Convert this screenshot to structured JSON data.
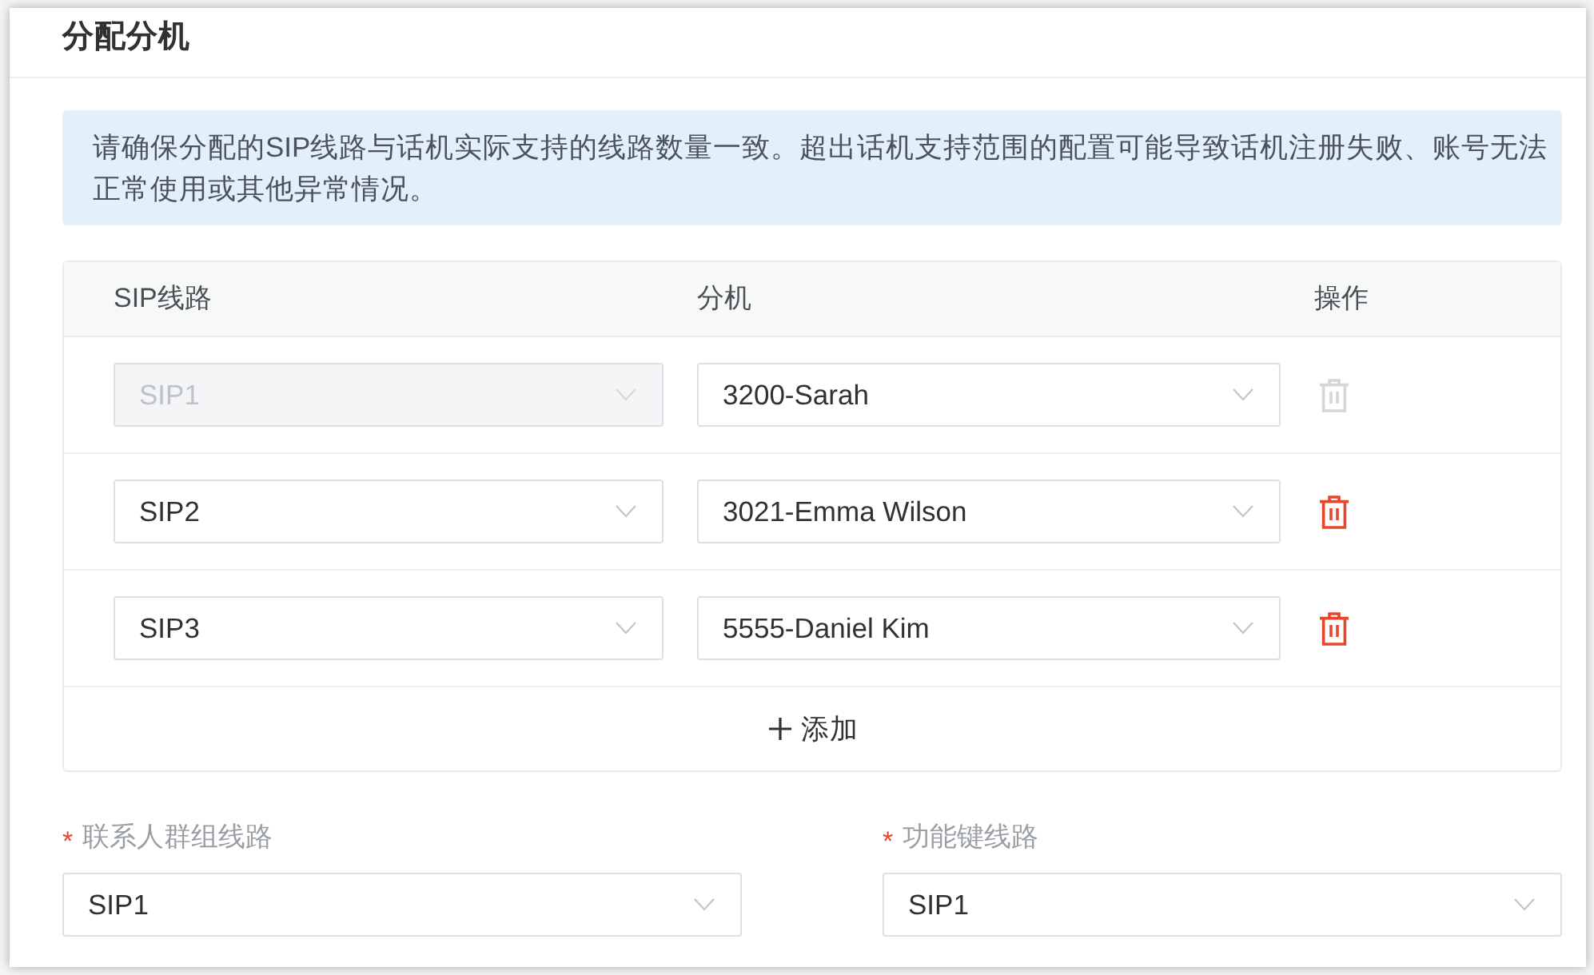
{
  "panel": {
    "title": "分配分机"
  },
  "notice": "请确保分配的SIP线路与话机实际支持的线路数量一致。超出话机支持范围的配置可能导致话机注册失败、账号无法正常使用或其他异常情况。",
  "table": {
    "columns": [
      "SIP线路",
      "分机",
      "操作"
    ],
    "rows": [
      {
        "sip_line": "SIP1",
        "sip_line_disabled": true,
        "extension": "3200-Sarah",
        "delete_disabled": true
      },
      {
        "sip_line": "SIP2",
        "sip_line_disabled": false,
        "extension": "3021-Emma Wilson",
        "delete_disabled": false
      },
      {
        "sip_line": "SIP3",
        "sip_line_disabled": false,
        "extension": "5555-Daniel Kim",
        "delete_disabled": false
      }
    ]
  },
  "add_button": {
    "label": "添加"
  },
  "fields": [
    {
      "required_mark": "*",
      "label": "联系人群组线路",
      "value": "SIP1"
    },
    {
      "required_mark": "*",
      "label": "功能键线路",
      "value": "SIP1"
    }
  ]
}
